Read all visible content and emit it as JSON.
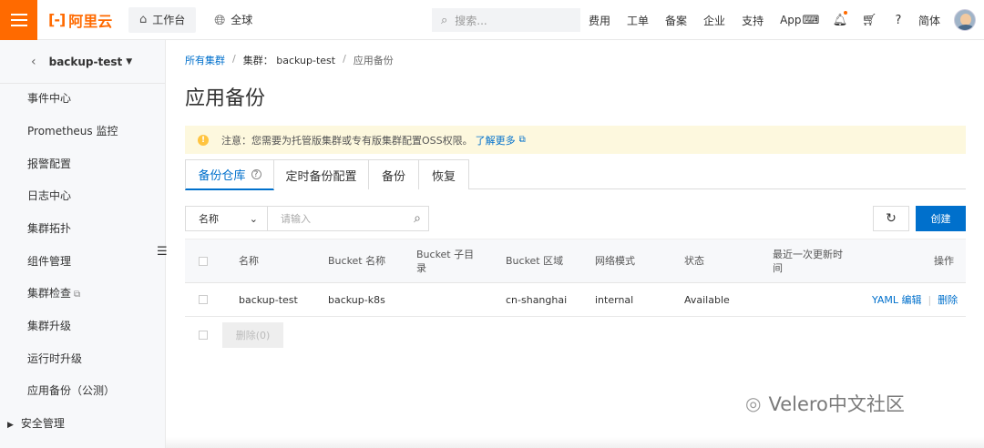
{
  "topbar": {
    "logo_mark": "[-]",
    "logo_text": "阿里云",
    "workbench": "工作台",
    "global": "全球",
    "search_placeholder": "搜索...",
    "nav": [
      "费用",
      "工单",
      "备案",
      "企业",
      "支持",
      "App"
    ],
    "language": "简体",
    "accent_color": "#ff6a00"
  },
  "sidebar": {
    "cluster_name": "backup-test",
    "items": [
      {
        "label": "事件中心"
      },
      {
        "label": "Prometheus 监控"
      },
      {
        "label": "报警配置"
      },
      {
        "label": "日志中心"
      },
      {
        "label": "集群拓扑"
      },
      {
        "label": "组件管理"
      },
      {
        "label": "集群检查"
      },
      {
        "label": "集群升级"
      },
      {
        "label": "运行时升级"
      },
      {
        "label": "应用备份（公测）"
      }
    ],
    "group": "安全管理"
  },
  "breadcrumb": {
    "all_clusters": "所有集群",
    "cluster": "集群：  backup-test",
    "current": "应用备份"
  },
  "page": {
    "title": "应用备份",
    "notice_text": "注意：您需要为托管版集群或专有版集群配置OSS权限。",
    "notice_link": "了解更多"
  },
  "tabs": [
    {
      "label": "备份仓库",
      "active": true
    },
    {
      "label": "定时备份配置"
    },
    {
      "label": "备份"
    },
    {
      "label": "恢复"
    }
  ],
  "filter": {
    "field": "名称",
    "placeholder": "请输入"
  },
  "buttons": {
    "create": "创建",
    "delete": "删除(0)"
  },
  "table": {
    "columns": [
      "名称",
      "Bucket 名称",
      "Bucket 子目录",
      "Bucket 区域",
      "网络模式",
      "状态",
      "最近一次更新时间",
      "操作"
    ],
    "rows": [
      {
        "name": "backup-test",
        "bucket": "backup-k8s",
        "subdir": "",
        "region": "cn-shanghai",
        "network": "internal",
        "status": "Available",
        "updated": "",
        "action_yaml": "YAML 编辑",
        "action_delete": "删除"
      }
    ]
  },
  "watermark": "Velero中文社区",
  "link_color": "#0070cc"
}
